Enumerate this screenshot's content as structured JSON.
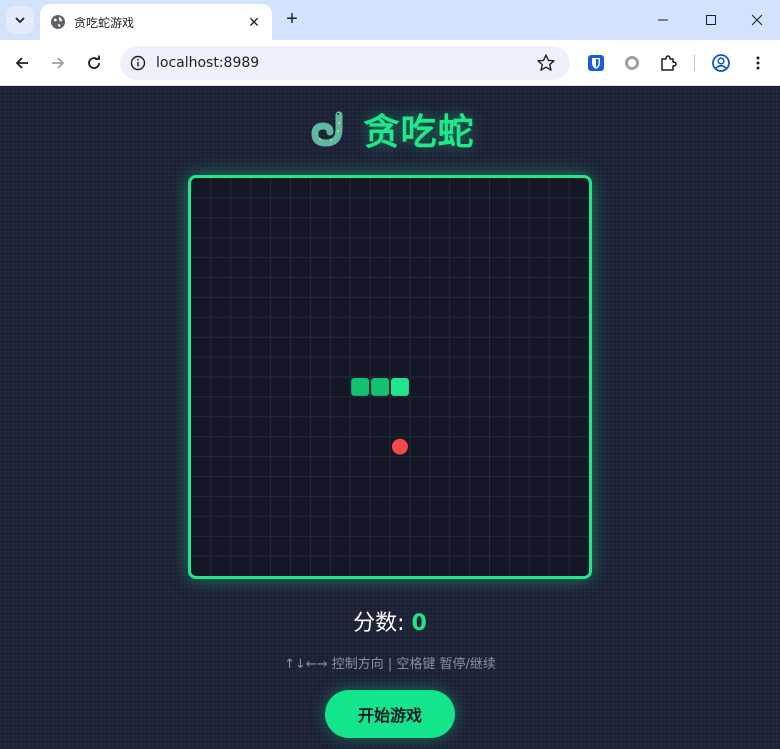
{
  "browser": {
    "tab_title": "贪吃蛇游戏",
    "url": "localhost:8989",
    "icons": [
      "tab-search-icon",
      "globe-icon",
      "close-icon",
      "plus-icon",
      "minimize-icon",
      "maximize-icon",
      "window-close-icon",
      "back-icon",
      "forward-icon",
      "reload-icon",
      "info-icon",
      "star-icon",
      "bitwarden-icon",
      "extension-circle-icon",
      "puzzle-icon",
      "profile-icon",
      "menu-icon"
    ]
  },
  "game": {
    "title": "贪吃蛇",
    "title_icon": "snake-icon",
    "grid_size": 20,
    "snake": [
      [
        8,
        10
      ],
      [
        9,
        10
      ],
      [
        10,
        10
      ]
    ],
    "food": [
      10,
      13
    ],
    "score_label": "分数:",
    "score": "0",
    "hint": "↑↓←→ 控制方向 | 空格键 暂停/继续",
    "start_label": "开始游戏",
    "colors": {
      "accent": "#1ee88a",
      "snake_body": "#13c26e",
      "snake_head": "#20e48e",
      "food": "#f24a4a",
      "board_bg": "#141725"
    }
  }
}
